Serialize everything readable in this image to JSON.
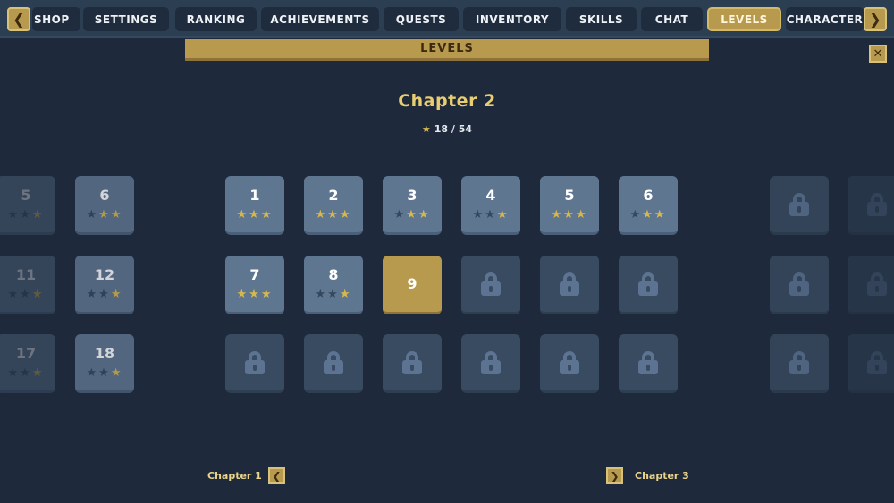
{
  "tabs": [
    {
      "label": "SHOP",
      "active": false
    },
    {
      "label": "SETTINGS",
      "active": false
    },
    {
      "label": "RANKING",
      "active": false
    },
    {
      "label": "ACHIEVEMENTS",
      "active": false
    },
    {
      "label": "QUESTS",
      "active": false
    },
    {
      "label": "INVENTORY",
      "active": false
    },
    {
      "label": "SKILLS",
      "active": false
    },
    {
      "label": "CHAT",
      "active": false
    },
    {
      "label": "LEVELS",
      "active": true
    },
    {
      "label": "CHARACTER",
      "active": false
    }
  ],
  "icons": {
    "prev": "chevron-left-icon",
    "next": "chevron-right-icon",
    "close": "close-icon",
    "star": "star-icon",
    "lock": "lock-icon"
  },
  "banner": {
    "title": "LEVELS"
  },
  "chapter": {
    "title": "Chapter 2",
    "stars": "18 / 54"
  },
  "prev_chapter": {
    "levels": [
      {
        "num": "5",
        "stars": [
          0,
          0,
          1
        ]
      },
      {
        "num": "6",
        "stars": [
          0,
          1,
          1
        ]
      },
      {
        "num": "11",
        "stars": [
          0,
          0,
          1
        ]
      },
      {
        "num": "12",
        "stars": [
          0,
          0,
          1
        ]
      },
      {
        "num": "17",
        "stars": [
          0,
          0,
          1
        ]
      },
      {
        "num": "18",
        "stars": [
          0,
          0,
          1
        ]
      }
    ]
  },
  "levels": [
    {
      "num": "1",
      "state": "done",
      "stars": [
        1,
        1,
        1
      ]
    },
    {
      "num": "2",
      "state": "done",
      "stars": [
        1,
        1,
        1
      ]
    },
    {
      "num": "3",
      "state": "done",
      "stars": [
        0,
        1,
        1
      ]
    },
    {
      "num": "4",
      "state": "done",
      "stars": [
        0,
        0,
        1
      ]
    },
    {
      "num": "5",
      "state": "done",
      "stars": [
        1,
        1,
        1
      ]
    },
    {
      "num": "6",
      "state": "done",
      "stars": [
        0,
        1,
        1
      ]
    },
    {
      "num": "7",
      "state": "done",
      "stars": [
        1,
        1,
        1
      ]
    },
    {
      "num": "8",
      "state": "done",
      "stars": [
        0,
        0,
        1
      ]
    },
    {
      "num": "9",
      "state": "current"
    },
    {
      "state": "locked"
    },
    {
      "state": "locked"
    },
    {
      "state": "locked"
    },
    {
      "state": "locked"
    },
    {
      "state": "locked"
    },
    {
      "state": "locked"
    },
    {
      "state": "locked"
    },
    {
      "state": "locked"
    },
    {
      "state": "locked"
    }
  ],
  "footer": {
    "prev_label": "Chapter 1",
    "next_label": "Chapter 3"
  },
  "colors": {
    "accent": "#b89a4e",
    "star_on": "#d9b84a",
    "star_off": "#34475d",
    "background": "#1e2a3c"
  }
}
